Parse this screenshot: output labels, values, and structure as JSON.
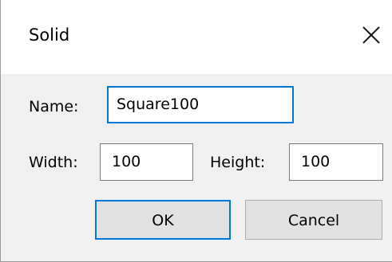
{
  "dialog": {
    "title": "Solid",
    "close_icon": "close-icon"
  },
  "form": {
    "name_label": "Name:",
    "name_value": "Square100",
    "width_label": "Width:",
    "width_value": "100",
    "height_label": "Height:",
    "height_value": "100"
  },
  "buttons": {
    "ok_label": "OK",
    "cancel_label": "Cancel"
  },
  "colors": {
    "focus_accent": "#0078d7",
    "dialog_background": "#f0f0f0",
    "titlebar_background": "#ffffff"
  }
}
